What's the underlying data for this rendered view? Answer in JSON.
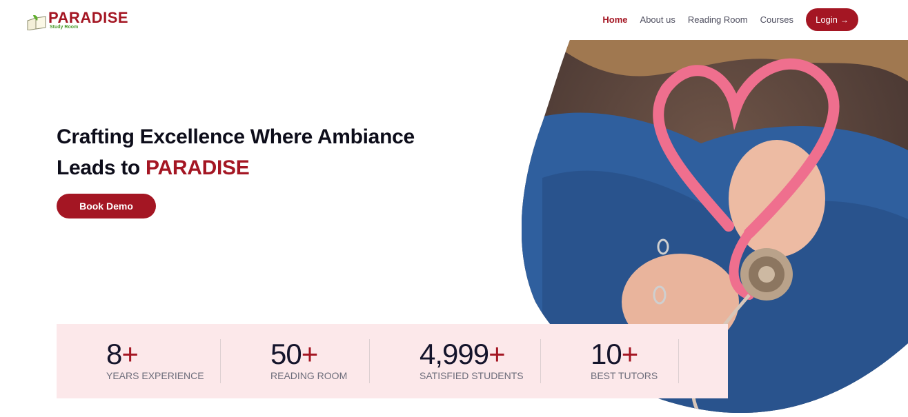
{
  "brand": {
    "name": "PARADISE",
    "tagline": "Study Room",
    "color": "#a41623"
  },
  "nav": {
    "items": [
      {
        "label": "Home",
        "active": true
      },
      {
        "label": "About us",
        "active": false
      },
      {
        "label": "Reading Room",
        "active": false
      },
      {
        "label": "Courses",
        "active": false
      }
    ],
    "login_label": "Login",
    "login_icon": "arrow-right-icon"
  },
  "hero": {
    "headline_line1": "Crafting Excellence Where Ambiance",
    "headline_line2_prefix": "Leads to ",
    "headline_accent": "PARADISE",
    "cta_label": "Book Demo"
  },
  "stats": [
    {
      "value": "8",
      "suffix": "+",
      "label": "YEARS EXPERIENCE"
    },
    {
      "value": "50",
      "suffix": "+",
      "label": "READING ROOM"
    },
    {
      "value": "4,999",
      "suffix": "+",
      "label": "SATISFIED STUDENTS"
    },
    {
      "value": "10",
      "suffix": "+",
      "label": "BEST TUTORS"
    }
  ]
}
